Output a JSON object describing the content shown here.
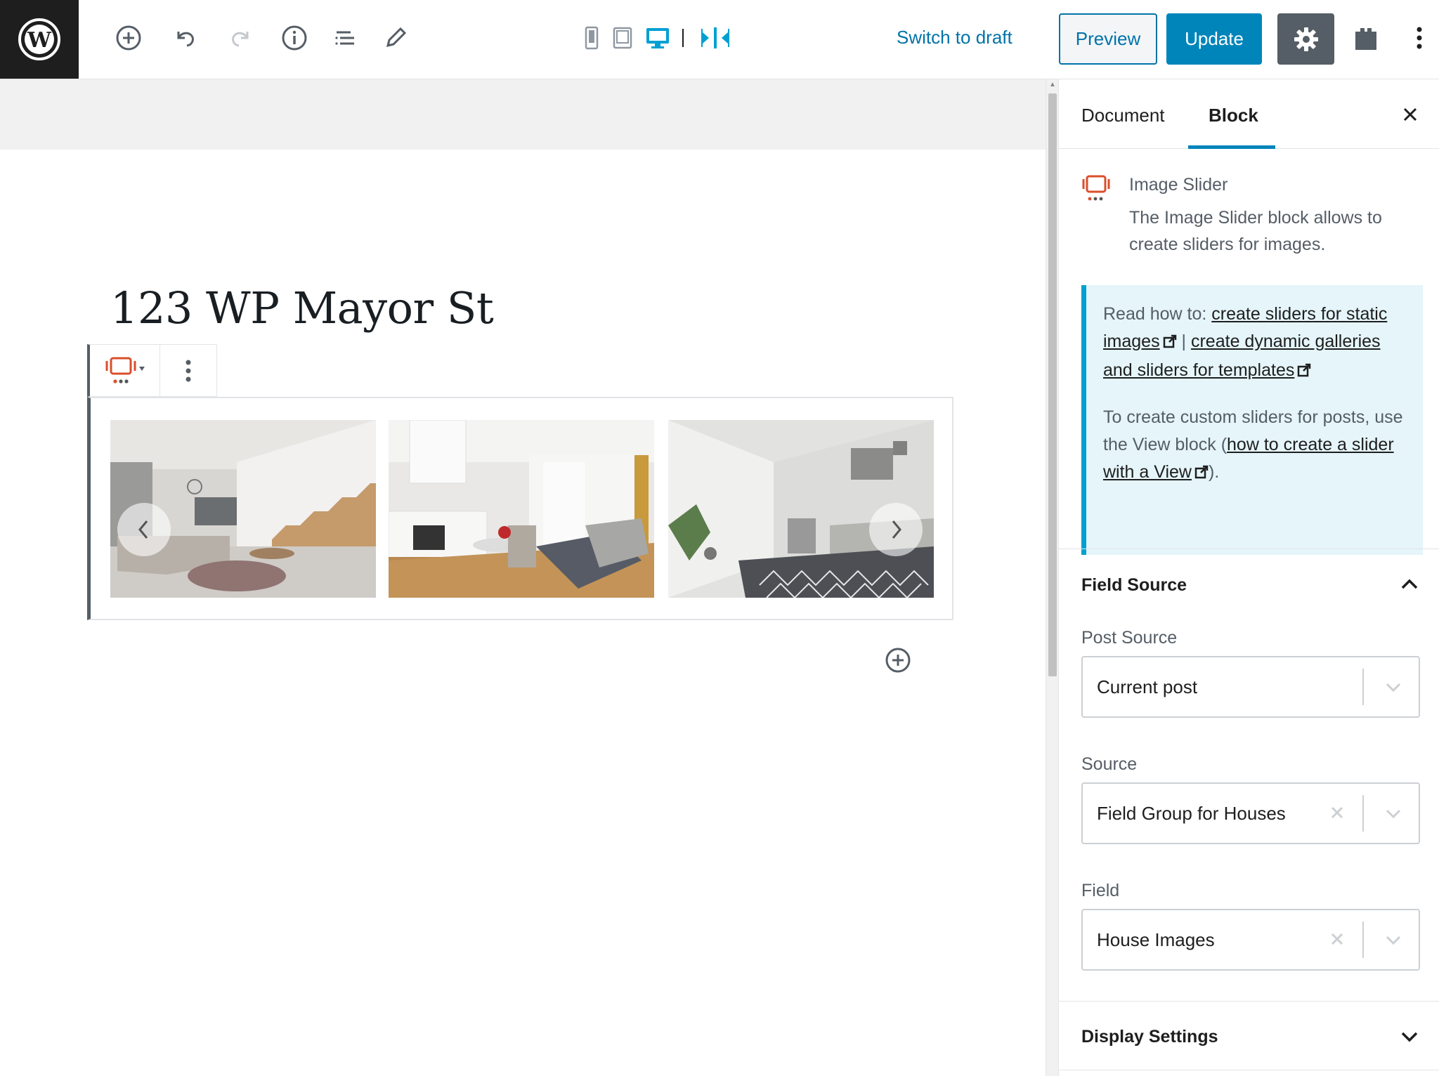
{
  "toolbar": {
    "switch_to_draft": "Switch to draft",
    "preview": "Preview",
    "update": "Update",
    "icons": [
      "wordpress-logo-icon",
      "add-block-icon",
      "undo-icon",
      "redo-icon",
      "info-icon",
      "list-view-icon",
      "edit-tools-icon",
      "mobile-preview-icon",
      "tablet-preview-icon",
      "desktop-preview-icon",
      "column-width-icon",
      "gear-icon",
      "block-library-icon",
      "more-options-icon"
    ]
  },
  "editor": {
    "post_title": "123 WP Mayor St",
    "slider": {
      "slide_count": 3,
      "prev_glyph": "‹",
      "next_glyph": "›"
    }
  },
  "sidebar": {
    "tabs": [
      "Document",
      "Block"
    ],
    "active_tab": "Block",
    "block_card": {
      "title": "Image Slider",
      "description": "The Image Slider block allows to create sliders for images."
    },
    "notice": {
      "read_how": "Read how to: ",
      "link1": "create sliders for static images",
      "separator": " | ",
      "link2": "create dynamic galleries and sliders for templates",
      "custom_text": "To create custom sliders for posts, use the View block (",
      "link3": "how to create a slider with a View",
      "closing": ")."
    },
    "field_source": {
      "title": "Field Source",
      "post_source_label": "Post Source",
      "post_source_value": "Current post",
      "source_label": "Source",
      "source_value": "Field Group for Houses",
      "field_label": "Field",
      "field_value": "House Images"
    },
    "display_settings": {
      "title": "Display Settings"
    }
  },
  "colors": {
    "accent_blue": "#0085ba",
    "link_blue": "#0073aa",
    "slider_icon_orange": "#d94f2b",
    "notice_bg": "#e5f5fa",
    "notice_border": "#00a0d2"
  }
}
